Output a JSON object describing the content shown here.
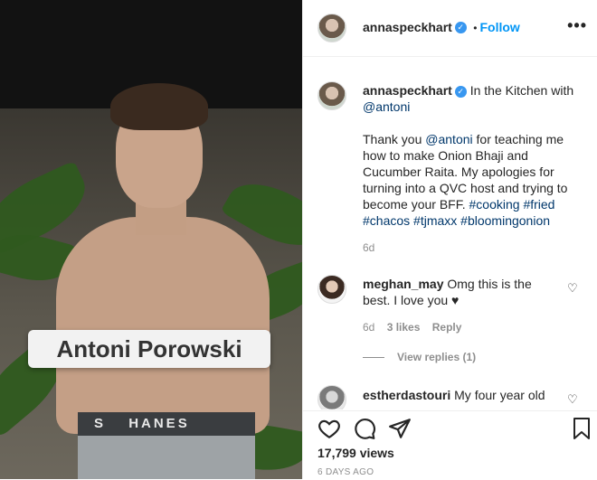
{
  "post": {
    "image_label": "Antoni Porowski",
    "waistband_text": "HANES",
    "waistband_prefix": "S"
  },
  "header": {
    "username": "annaspeckhart",
    "separator": "•",
    "follow_label": "Follow",
    "more_icon": "more-horizontal-icon",
    "verified_glyph": "✓"
  },
  "caption": {
    "username": "annaspeckhart",
    "location_text": "In the Kitchen with",
    "mention_first": "@antoni",
    "body_pre": "Thank you",
    "body_mention": "@antoni",
    "body_text": "for teaching me how to make Onion Bhaji and Cucumber Raita. My apologies for turning into a QVC host and trying to become your BFF.",
    "hashtags": [
      "#cooking",
      "#fried",
      "#chacos",
      "#tjmaxx",
      "#bloomingonion"
    ],
    "time": "6d"
  },
  "comments": [
    {
      "username": "meghan_may",
      "text": "Omg this is the best. I love you ♥",
      "time": "6d",
      "likes": "3 likes",
      "reply_label": "Reply",
      "view_replies": "View replies (1)"
    },
    {
      "username": "estherdastouri",
      "text": "My four year old"
    }
  ],
  "actions": {
    "views": "17,799 views",
    "date": "6 DAYS AGO"
  },
  "colors": {
    "accent": "#0095f6",
    "verified": "#3897f0",
    "muted": "#8e8e8e",
    "link": "#00376b"
  }
}
